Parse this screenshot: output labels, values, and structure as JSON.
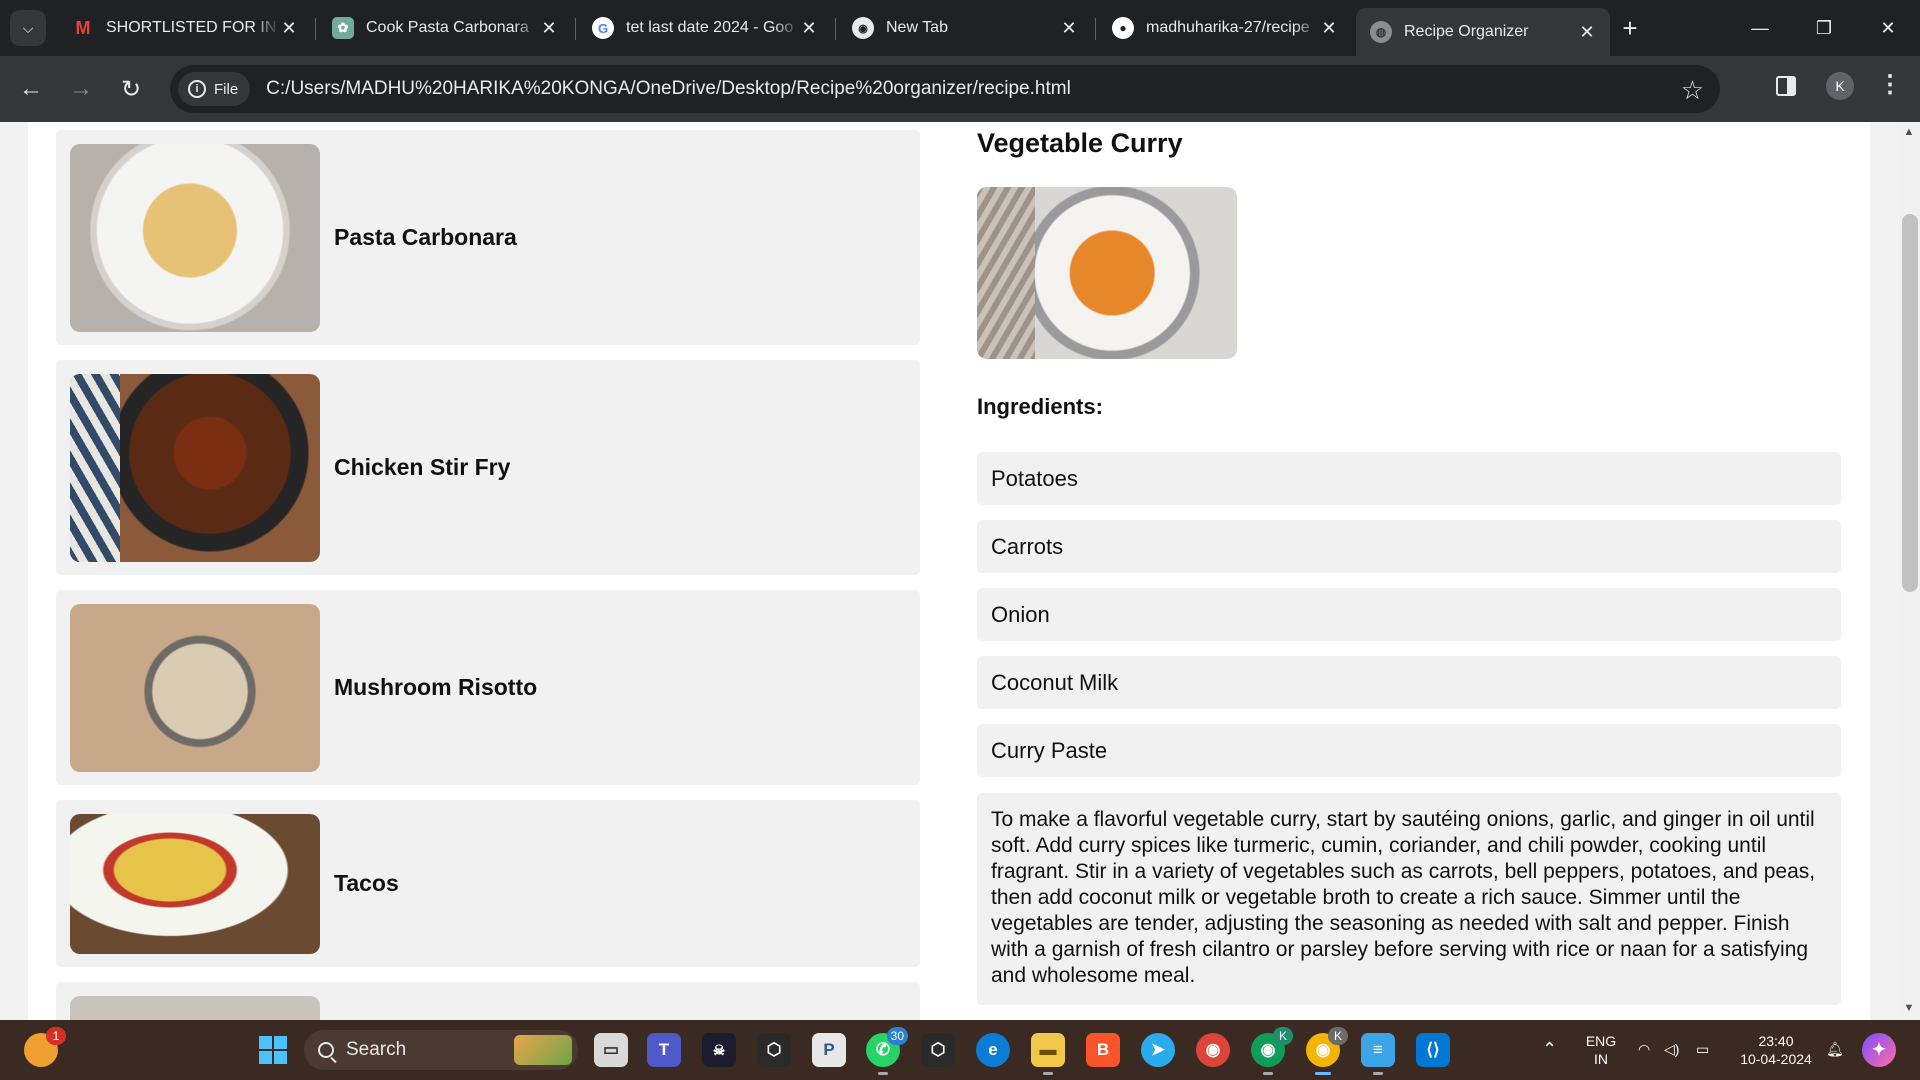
{
  "browser": {
    "tabs": [
      {
        "title": "SHORTLISTED FOR INTE",
        "icon": "gmail-icon"
      },
      {
        "title": "Cook Pasta Carbonara",
        "icon": "chatgpt-icon"
      },
      {
        "title": "tet last date 2024 - Goo",
        "icon": "google-icon"
      },
      {
        "title": "New Tab",
        "icon": "chrome-icon"
      },
      {
        "title": "madhuharika-27/recipe",
        "icon": "github-icon"
      },
      {
        "title": "Recipe Organizer",
        "icon": "globe-icon"
      }
    ],
    "site_chip": "File",
    "url": "C:/Users/MADHU%20HARIKA%20KONGA/OneDrive/Desktop/Recipe%20organizer/recipe.html",
    "profile_initial": "K"
  },
  "page": {
    "recipes": [
      {
        "name": "Pasta Carbonara"
      },
      {
        "name": "Chicken Stir Fry"
      },
      {
        "name": "Mushroom Risotto"
      },
      {
        "name": "Tacos"
      }
    ],
    "detail": {
      "title": "Vegetable Curry",
      "ingredients_heading": "Ingredients:",
      "ingredients": [
        "Potatoes",
        "Carrots",
        "Onion",
        "Coconut Milk",
        "Curry Paste"
      ],
      "instructions": "To make a flavorful vegetable curry, start by sautéing onions, garlic, and ginger in oil until soft. Add curry spices like turmeric, cumin, coriander, and chili powder, cooking until fragrant. Stir in a variety of vegetables such as carrots, bell peppers, potatoes, and peas, then add coconut milk or vegetable broth to create a rich sauce. Simmer until the vegetables are tender, adjusting the seasoning as needed with salt and pepper. Finish with a garnish of fresh cilantro or parsley before serving with rice or naan for a satisfying and wholesome meal."
    }
  },
  "taskbar": {
    "search_label": "Search",
    "weather_badge": "1",
    "whatsapp_badge": "30",
    "chrome_profile_badge": "K",
    "language_line1": "ENG",
    "language_line2": "IN",
    "time": "23:40",
    "date": "10-04-2024"
  },
  "colors": {
    "tab_strip": "#202124",
    "toolbar": "#35363a",
    "card_bg": "#f1f1f1",
    "taskbar": "#3b2a22"
  }
}
